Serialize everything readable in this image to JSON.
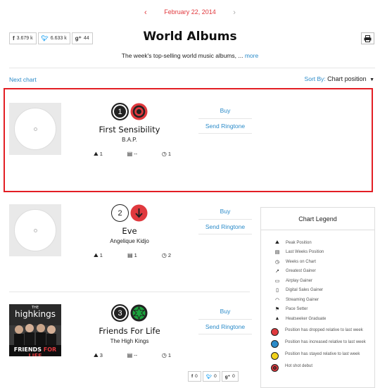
{
  "date_nav": {
    "prev_icon": "chevron-left",
    "date": "February 22, 2014",
    "next_icon": "chevron-right"
  },
  "social": [
    {
      "icon": "facebook-icon",
      "glyph": "f",
      "count": "3.679 k"
    },
    {
      "icon": "twitter-icon",
      "glyph": "t",
      "count": "6.633 k"
    },
    {
      "icon": "google-plus-icon",
      "glyph": "g⁺",
      "count": "44"
    }
  ],
  "page": {
    "title": "World Albums",
    "subtitle": "The week's top-selling world music albums, ...",
    "more_link": "more",
    "print_icon": "printer-icon"
  },
  "controls": {
    "next_chart": "Next chart",
    "sort_label": "Sort By:",
    "sort_value": "Chart position"
  },
  "entries": [
    {
      "rank": "1",
      "movement": "hot-shot-debut",
      "title": "First Sensibility",
      "artist": "B.A.P.",
      "peak": "1",
      "last_week": "--",
      "weeks": "1",
      "buy": "Buy",
      "ringtone": "Send Ringtone"
    },
    {
      "rank": "2",
      "movement": "dropped",
      "title": "Eve",
      "artist": "Angelique Kidjo",
      "peak": "1",
      "last_week": "1",
      "weeks": "2",
      "buy": "Buy",
      "ringtone": "Send Ringtone"
    },
    {
      "rank": "3",
      "movement": "debut-green",
      "title": "Friends For Life",
      "artist": "The High Kings",
      "peak": "3",
      "last_week": "--",
      "weeks": "1",
      "buy": "Buy",
      "ringtone": "Send Ringtone",
      "art_text": {
        "top": "THE",
        "band": "highkings",
        "bottom_a": "FRIENDS",
        "bottom_b": "FOR LIFE"
      }
    }
  ],
  "legend": {
    "title": "Chart Legend",
    "items": [
      {
        "icon": "peak-icon",
        "label": "Peak Position"
      },
      {
        "icon": "last-week-icon",
        "label": "Last Weeks Position"
      },
      {
        "icon": "clock-icon",
        "label": "Weeks on Chart"
      },
      {
        "icon": "gainer-icon",
        "label": "Greatest Gainer"
      },
      {
        "icon": "radio-icon",
        "label": "Airplay Gainer"
      },
      {
        "icon": "phone-icon",
        "label": "Digital Sales Gainer"
      },
      {
        "icon": "wifi-icon",
        "label": "Streaming Gainer"
      },
      {
        "icon": "flag-icon",
        "label": "Pace Setter"
      },
      {
        "icon": "bell-icon",
        "label": "Heatseeker Graduate"
      }
    ],
    "dots": [
      {
        "icon": "dropped-icon",
        "color": "#e0393e",
        "label": "Position has dropped relative to last week"
      },
      {
        "icon": "increased-icon",
        "color": "#2b8bc9",
        "label": "Position has increased relative to last week"
      },
      {
        "icon": "stayed-icon",
        "color": "#f2d21b",
        "label": "Position has stayed relative to last week"
      },
      {
        "icon": "hot-shot-icon",
        "color": "#e0393e",
        "label": "Hot shot debut"
      }
    ]
  },
  "bottom_social": [
    {
      "icon": "facebook-icon",
      "glyph": "f",
      "count": "0"
    },
    {
      "icon": "twitter-icon",
      "glyph": "t",
      "count": "0"
    },
    {
      "icon": "google-plus-icon",
      "glyph": "g⁺",
      "count": "0"
    }
  ],
  "colors": {
    "accent": "#2b8bc9",
    "red": "#e0393e",
    "highlight": "#e31e24",
    "green": "#1aa33c"
  }
}
